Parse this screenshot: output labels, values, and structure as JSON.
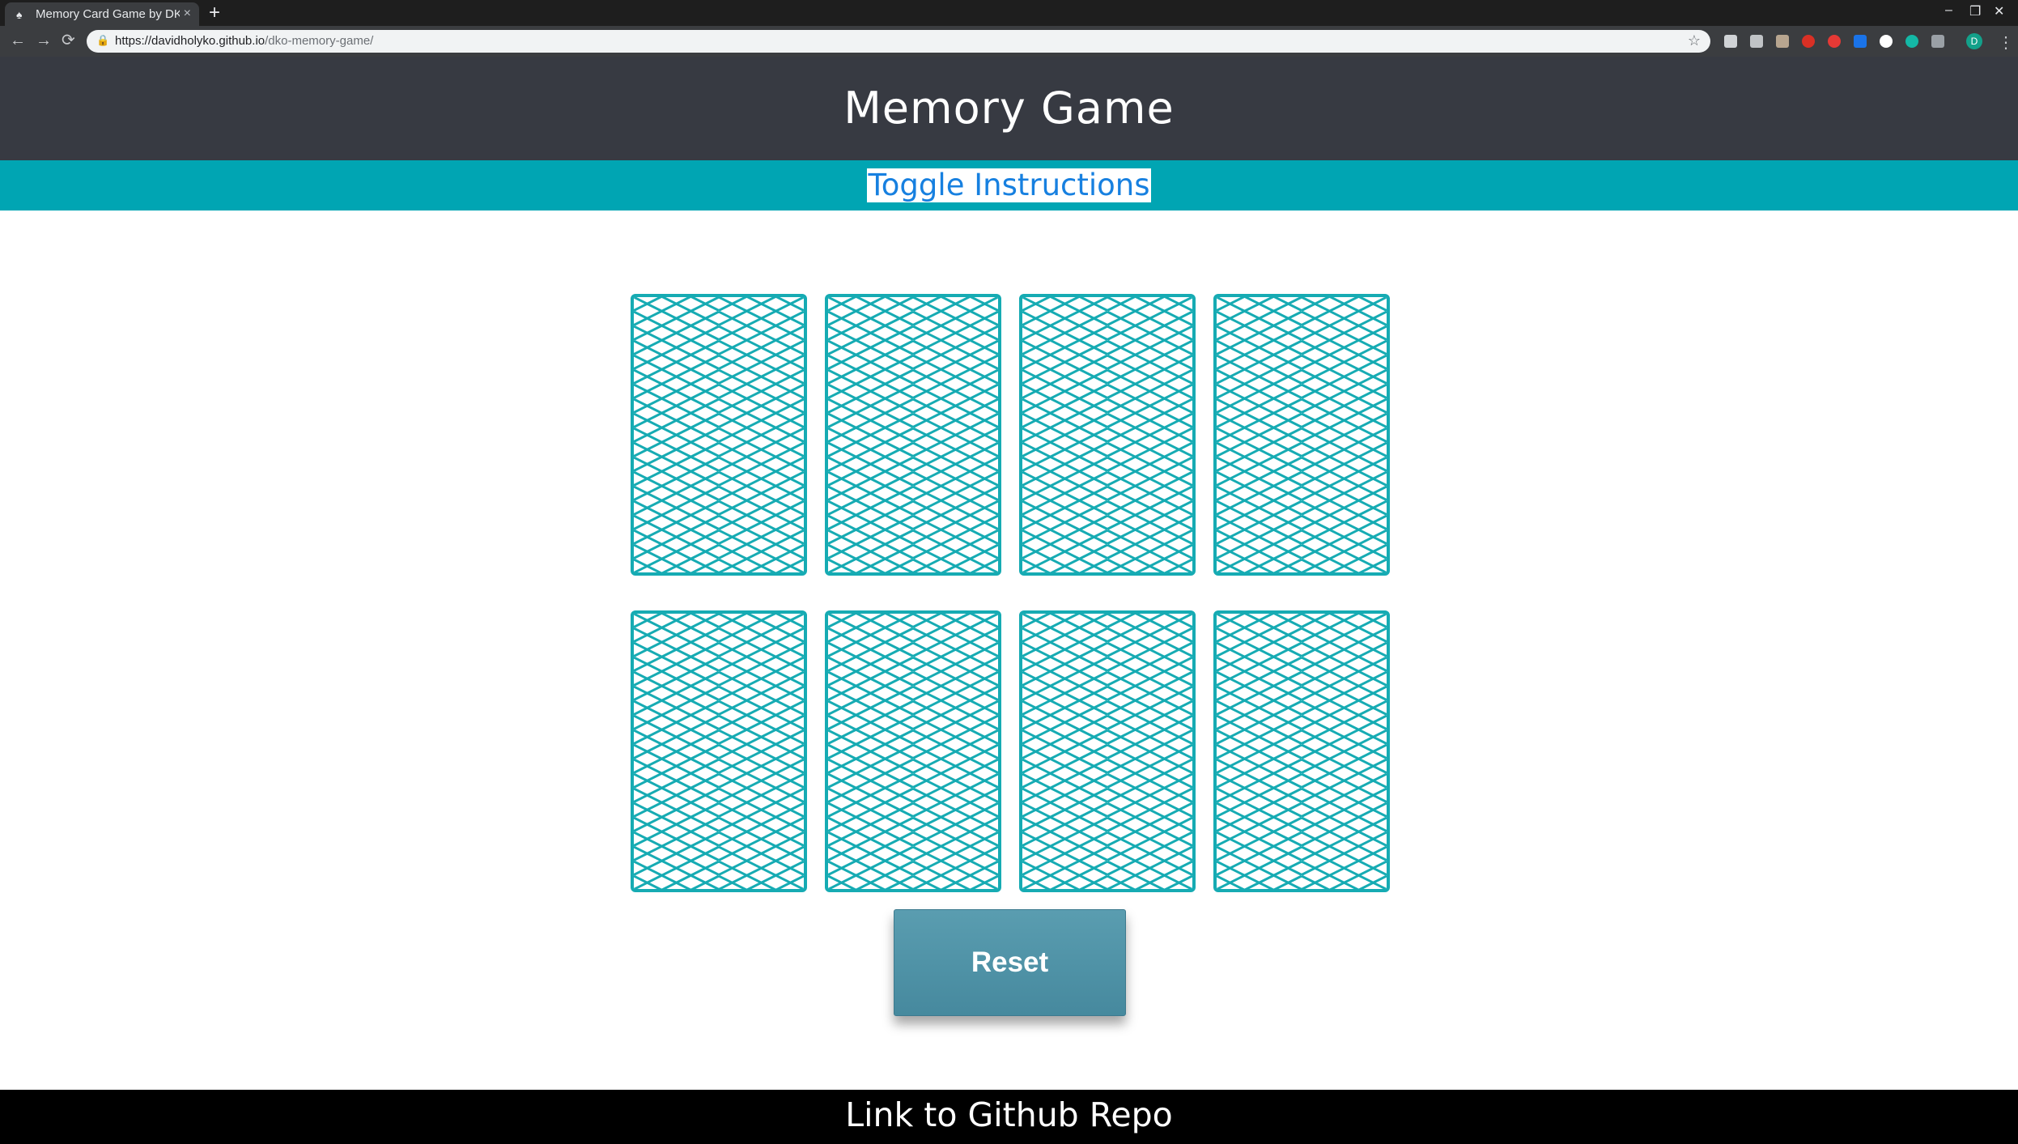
{
  "browser": {
    "tab_title": "Memory Card Game by DK",
    "tab_close": "×",
    "new_tab": "+",
    "url_host": "https://davidholyko.github.io",
    "url_path": "/dko-memory-game/",
    "back": "←",
    "forward": "→",
    "reload": "⟳",
    "star": "☆",
    "profile_initial": "D",
    "window_controls": [
      "–",
      "❐",
      "✕"
    ]
  },
  "page": {
    "title": "Memory Game",
    "toggle_instructions_label": "Toggle Instructions",
    "reset_label": "Reset",
    "footer_link_label": "Link to Github Repo"
  },
  "cards": [
    {
      "state": "face-down"
    },
    {
      "state": "face-down"
    },
    {
      "state": "face-down"
    },
    {
      "state": "face-down"
    },
    {
      "state": "face-down"
    },
    {
      "state": "face-down"
    },
    {
      "state": "face-down"
    },
    {
      "state": "face-down"
    }
  ],
  "colors": {
    "header_bg": "#373a42",
    "band_bg": "#00a5b3",
    "card_pattern": "#16abb3",
    "toggle_text": "#1780e0",
    "reset_bg": "#4f93a7",
    "footer_bg": "#000000"
  }
}
